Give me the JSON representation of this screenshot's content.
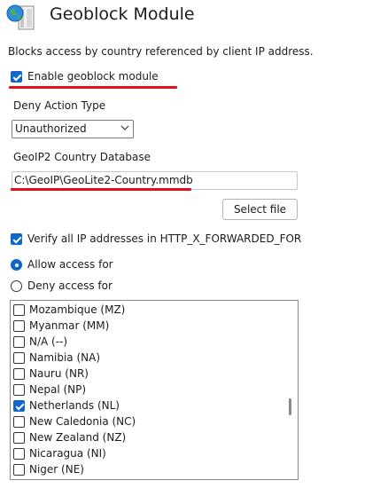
{
  "window": {
    "title": "Geoblock Module",
    "icon": "globe-document-icon"
  },
  "description": "Blocks access by country referenced by client IP address.",
  "enable_module": {
    "label": "Enable geoblock module",
    "checked": true
  },
  "deny_action": {
    "label": "Deny Action Type",
    "value": "Unauthorized"
  },
  "database": {
    "label": "GeoIP2 Country Database",
    "value": "C:\\GeoIP\\GeoLite2-Country.mmdb",
    "button": "Select file"
  },
  "verify_forwarded": {
    "label": "Verify all IP addresses in HTTP_X_FORWARDED_FOR",
    "checked": true
  },
  "access_mode": {
    "allow_label": "Allow access for",
    "deny_label": "Deny access for",
    "selected": "allow"
  },
  "countries": [
    {
      "label": "Mozambique (MZ)",
      "checked": false
    },
    {
      "label": "Myanmar (MM)",
      "checked": false
    },
    {
      "label": "N/A (--)",
      "checked": false
    },
    {
      "label": "Namibia (NA)",
      "checked": false
    },
    {
      "label": "Nauru (NR)",
      "checked": false
    },
    {
      "label": "Nepal (NP)",
      "checked": false
    },
    {
      "label": "Netherlands (NL)",
      "checked": true
    },
    {
      "label": "New Caledonia (NC)",
      "checked": false
    },
    {
      "label": "New Zealand (NZ)",
      "checked": false
    },
    {
      "label": "Nicaragua (NI)",
      "checked": false
    },
    {
      "label": "Niger (NE)",
      "checked": false
    }
  ],
  "colors": {
    "accent": "#0f67c9",
    "annotation": "#e0101c"
  }
}
